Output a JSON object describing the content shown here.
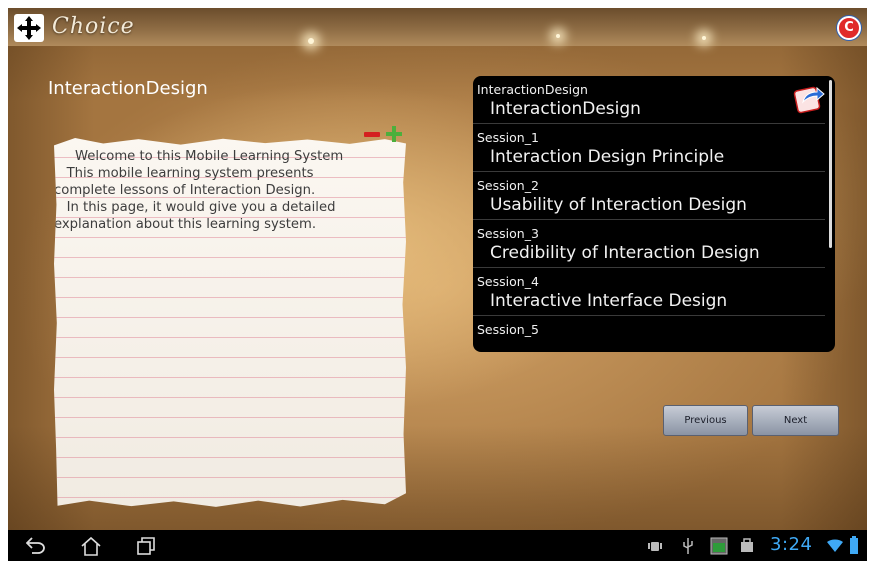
{
  "app": {
    "logo_text": "Choice",
    "app_icon_letter": "C"
  },
  "page": {
    "title": "InteractionDesign"
  },
  "note": {
    "text": "     Welcome to this Mobile Learning System\n   This mobile learning system presents\ncomplete lessons of Interaction Design.\n   In this page, it would give you a detailed\nexplanation about this learning system."
  },
  "session_list": {
    "items": [
      {
        "label": "InteractionDesign",
        "title": "InteractionDesign"
      },
      {
        "label": "Session_1",
        "title": "Interaction Design Principle"
      },
      {
        "label": "Session_2",
        "title": "Usability of Interaction Design"
      },
      {
        "label": "Session_3",
        "title": "Credibility of Interaction Design"
      },
      {
        "label": "Session_4",
        "title": "Interactive Interface Design"
      },
      {
        "label": "Session_5",
        "title": ""
      }
    ]
  },
  "buttons": {
    "previous": "Previous",
    "next": "Next"
  },
  "status": {
    "time": "3:24"
  },
  "icons": {
    "menu": "plus-cross-icon",
    "zoom_out": "minus-icon",
    "zoom_in": "plus-icon",
    "share": "share-icon",
    "back": "back-icon",
    "home": "home-icon",
    "recents": "recent-apps-icon"
  },
  "colors": {
    "list_background": "#000000",
    "time_color": "#3fa9f5",
    "zoom_out": "#d42020",
    "zoom_in": "#4caf3c"
  }
}
